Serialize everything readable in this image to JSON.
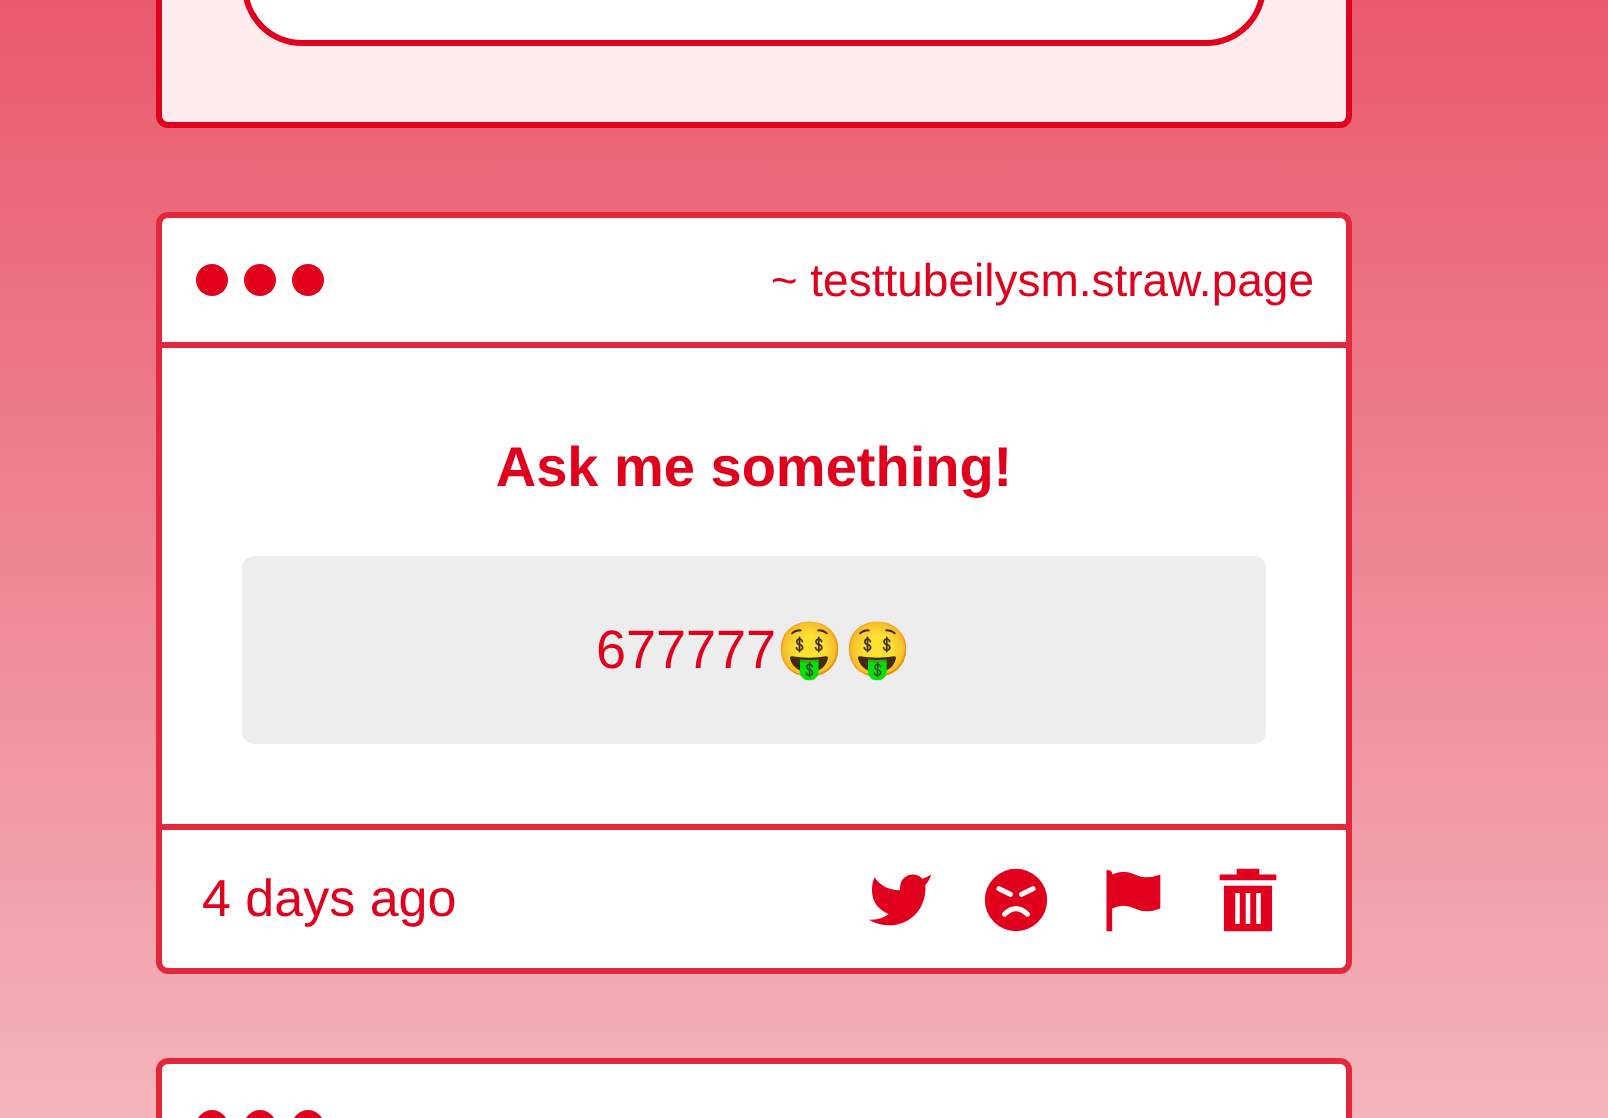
{
  "cards": [
    {
      "url": "~ testtubeilysm.straw.page",
      "heading": "Ask me something!",
      "question": "677777🤑🤑",
      "time": "4 days ago"
    }
  ]
}
